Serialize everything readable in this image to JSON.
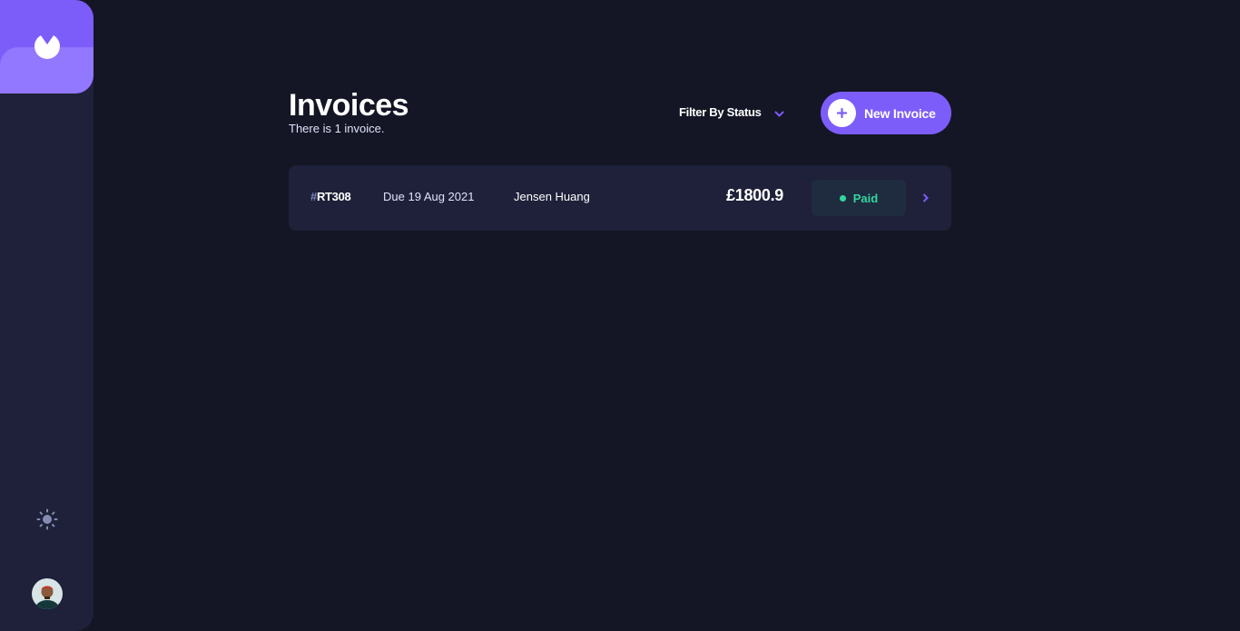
{
  "header": {
    "title": "Invoices",
    "subtitle": "There is 1 invoice.",
    "filter_label": "Filter By Status",
    "new_invoice_label": "New Invoice"
  },
  "sidebar": {
    "logo_icon": "logo-icon",
    "theme_icon": "sun-icon",
    "avatar": "user-avatar"
  },
  "invoices": [
    {
      "hash": "#",
      "id": "RT308",
      "due": "Due 19 Aug 2021",
      "client": "Jensen Huang",
      "amount": "£1800.9",
      "status": "Paid"
    }
  ],
  "colors": {
    "background": "#141625",
    "sidebar": "#1e2139",
    "accent": "#7c5dfa",
    "accent_light": "#9277ff",
    "paid": "#33d69f"
  }
}
